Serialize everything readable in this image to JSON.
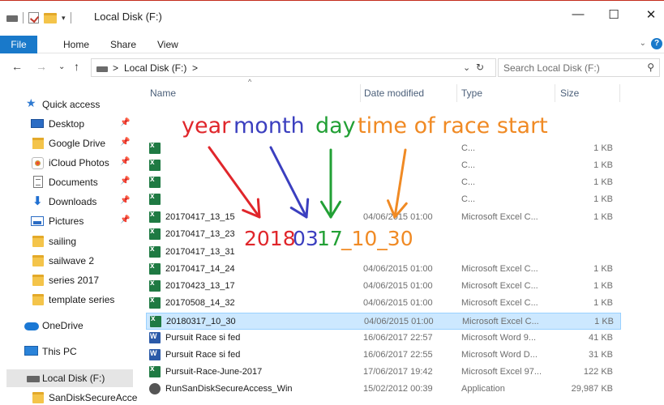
{
  "window": {
    "title": "Local Disk (F:)",
    "minimize_glyph": "—",
    "maximize_glyph": "☐",
    "close_glyph": "✕",
    "quick_access_dropdown": "▾"
  },
  "ribbon": {
    "tabs": [
      "File",
      "Home",
      "Share",
      "View"
    ],
    "expand_glyph": "⌄",
    "help_glyph": "?"
  },
  "navigation": {
    "back": "←",
    "forward": "→",
    "recent": "⌄",
    "up": "↑",
    "breadcrumb": [
      "Local Disk (F:)"
    ],
    "separator": ">",
    "dropdown": "⌄",
    "refresh": "↻"
  },
  "search": {
    "placeholder": "Search Local Disk (F:)",
    "icon": "search-icon"
  },
  "sidebar": {
    "items": [
      {
        "label": "Quick access",
        "icon": "star-icon",
        "pinned": false
      },
      {
        "label": "Desktop",
        "icon": "desktop-icon",
        "pinned": true
      },
      {
        "label": "Google Drive",
        "icon": "folder-icon",
        "pinned": true
      },
      {
        "label": "iCloud Photos",
        "icon": "icloud-photos-icon",
        "pinned": true
      },
      {
        "label": "Documents",
        "icon": "documents-icon",
        "pinned": true
      },
      {
        "label": "Downloads",
        "icon": "download-icon",
        "pinned": true
      },
      {
        "label": "Pictures",
        "icon": "pictures-icon",
        "pinned": true
      },
      {
        "label": "sailing",
        "icon": "folder-icon",
        "pinned": false
      },
      {
        "label": "sailwave 2",
        "icon": "folder-icon",
        "pinned": false
      },
      {
        "label": "series 2017",
        "icon": "folder-icon",
        "pinned": false
      },
      {
        "label": "template series",
        "icon": "folder-icon",
        "pinned": false
      },
      {
        "label": "OneDrive",
        "icon": "onedrive-icon",
        "pinned": false
      },
      {
        "label": "This PC",
        "icon": "pc-icon",
        "pinned": false
      },
      {
        "label": "Local Disk (F:)",
        "icon": "drive-icon",
        "pinned": false,
        "selected": true
      },
      {
        "label": "SanDiskSecureAcce",
        "icon": "folder-icon",
        "pinned": false
      }
    ],
    "pin_glyph": "📌"
  },
  "columns": {
    "name": "Name",
    "date": "Date modified",
    "type": "Type",
    "size": "Size",
    "sort_glyph": "^"
  },
  "files": [
    {
      "name": "",
      "date": "",
      "type": "C...",
      "size": "1 KB",
      "icon": "excel-file-icon"
    },
    {
      "name": "",
      "date": "",
      "type": "C...",
      "size": "1 KB",
      "icon": "excel-file-icon"
    },
    {
      "name": "",
      "date": "",
      "type": "C...",
      "size": "1 KB",
      "icon": "excel-file-icon"
    },
    {
      "name": "",
      "date": "",
      "type": "C...",
      "size": "1 KB",
      "icon": "excel-file-icon"
    },
    {
      "name": "20170417_13_15",
      "date": "04/06/2015 01:00",
      "type": "Microsoft Excel C...",
      "size": "1 KB",
      "icon": "excel-file-icon"
    },
    {
      "name": "20170417_13_23",
      "date": "",
      "type": "",
      "size": "",
      "icon": "excel-file-icon"
    },
    {
      "name": "20170417_13_31",
      "date": "",
      "type": "",
      "size": "",
      "icon": "excel-file-icon"
    },
    {
      "name": "20170417_14_24",
      "date": "04/06/2015 01:00",
      "type": "Microsoft Excel C...",
      "size": "1 KB",
      "icon": "excel-file-icon"
    },
    {
      "name": "20170423_13_17",
      "date": "04/06/2015 01:00",
      "type": "Microsoft Excel C...",
      "size": "1 KB",
      "icon": "excel-file-icon"
    },
    {
      "name": "20170508_14_32",
      "date": "04/06/2015 01:00",
      "type": "Microsoft Excel C...",
      "size": "1 KB",
      "icon": "excel-file-icon"
    },
    {
      "name": "20180317_10_30",
      "date": "04/06/2015 01:00",
      "type": "Microsoft Excel C...",
      "size": "1 KB",
      "icon": "excel-file-icon",
      "selected": true
    },
    {
      "name": "Pursuit Race si fed",
      "date": "16/06/2017 22:57",
      "type": "Microsoft Word 9...",
      "size": "41 KB",
      "icon": "word-file-icon"
    },
    {
      "name": "Pursuit Race si fed",
      "date": "16/06/2017 22:55",
      "type": "Microsoft Word D...",
      "size": "31 KB",
      "icon": "word-file-icon"
    },
    {
      "name": "Pursuit-Race-June-2017",
      "date": "17/06/2017 19:42",
      "type": "Microsoft Excel 97...",
      "size": "122 KB",
      "icon": "excel-file-icon"
    },
    {
      "name": "RunSanDiskSecureAccess_Win",
      "date": "15/02/2012 00:39",
      "type": "Application",
      "size": "29,987 KB",
      "icon": "application-icon"
    }
  ],
  "annotation": {
    "labels": {
      "year": "year",
      "month": "month",
      "day": "day",
      "time": "time of race start"
    },
    "example": {
      "year": "2018",
      "month": "03",
      "day": "17",
      "time": "_10_30"
    },
    "colors": {
      "year": "#e0262b",
      "month": "#3b3fbf",
      "day": "#22a035",
      "time": "#f08a24"
    }
  }
}
